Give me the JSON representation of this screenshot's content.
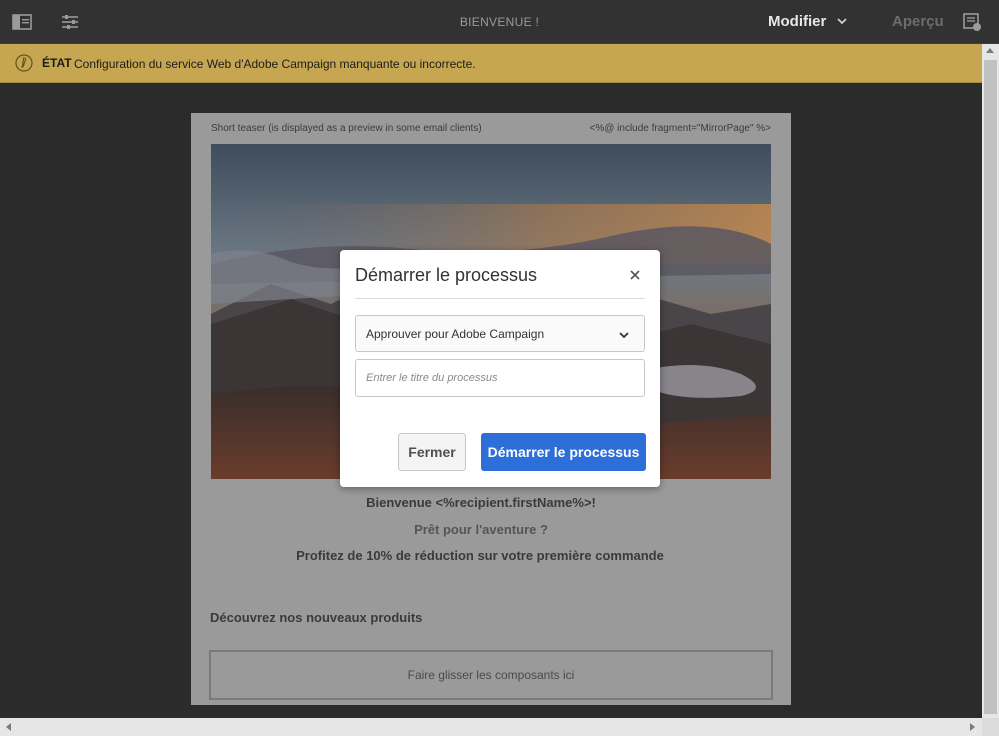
{
  "toolbar": {
    "title": "BIENVENUE !",
    "modifier_label": "Modifier",
    "apercu_label": "Aperçu",
    "left_icons": [
      "side-panel-icon",
      "properties-icon"
    ],
    "right_icon": "annotations-icon"
  },
  "status": {
    "icon": "status-circle-icon",
    "label": "ÉTAT",
    "message": "Configuration du service Web d'Adobe Campaign manquante ou incorrecte.",
    "background": "#c7a651"
  },
  "email": {
    "teaser": "Short teaser (is displayed as a preview in some email clients)",
    "mirror_page": "<%@ include fragment=\"MirrorPage\" %>",
    "welcome": "Bienvenue <%recipient.firstName%>!",
    "ready": "Prêt pour l'aventure ?",
    "promo": "Profitez de 10% de réduction sur votre première commande",
    "products_heading": "Découvrez nos nouveaux produits",
    "dropzone": "Faire glisser les composants ici"
  },
  "dialog": {
    "title": "Démarrer le processus",
    "select_value": "Approuver pour Adobe Campaign",
    "input_placeholder": "Entrer le titre du processus",
    "input_value": "",
    "close_button": "Fermer",
    "start_button": "Démarrer le processus",
    "accent": "#2d6ed8"
  }
}
